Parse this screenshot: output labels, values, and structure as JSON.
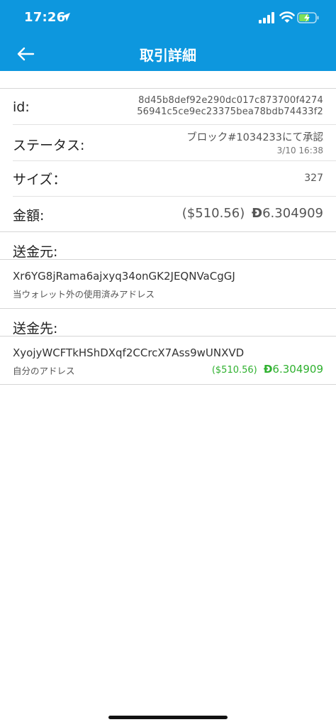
{
  "status_bar": {
    "time": "17:26"
  },
  "nav": {
    "title": "取引詳細"
  },
  "details": {
    "id_label": "id:",
    "id_line1": "8d45b8def92e290dc017c873700f4274",
    "id_line2": "56941c5ce9ec23375bea78bdb74433f2",
    "status_label": "ステータス:",
    "status_value": "ブロック#1034233にて承認",
    "status_date": "3/10 16:38",
    "size_label": "サイズ：",
    "size_value": "327",
    "amount_label": "金額:",
    "amount_usd": "($510.56)",
    "amount_symbol": "Ð",
    "amount_value": "6.304909"
  },
  "sender": {
    "header": "送金元:",
    "address": "Xr6YG8jRama6ajxyq34onGK2JEQNVaCgGJ",
    "note": "当ウォレット外の使用済みアドレス"
  },
  "recipient": {
    "header": "送金先:",
    "address": "XyojyWCFTkHShDXqf2CCrcX7Ass9wUNXVD",
    "note": "自分のアドレス",
    "amount_usd": "($510.56)",
    "amount_symbol": "Ð",
    "amount_value": "6.304909"
  },
  "colors": {
    "header_bg": "#0d97de",
    "accent_green": "#2fb12f"
  }
}
